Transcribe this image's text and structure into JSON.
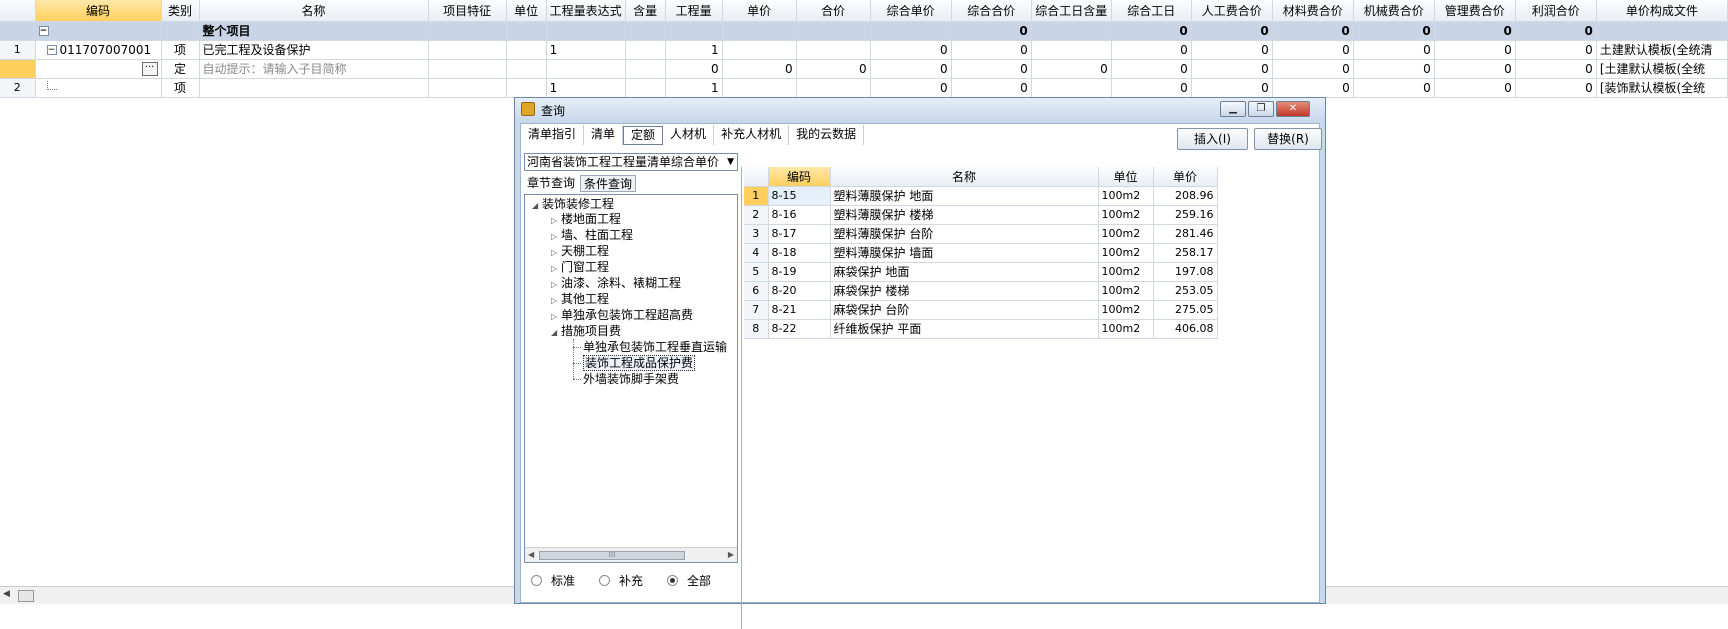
{
  "grid": {
    "headers": [
      "编码",
      "类别",
      "名称",
      "项目特征",
      "单位",
      "工程量表达式",
      "含量",
      "工程量",
      "单价",
      "合价",
      "综合单价",
      "综合合价",
      "综合工日含量",
      "综合工日",
      "人工费合价",
      "材料费合价",
      "机械费合价",
      "管理费合价",
      "利润合价",
      "单价构成文件"
    ],
    "summary": {
      "toggle": "−",
      "name": "整个项目",
      "zhhj": "0",
      "zhgr": "0",
      "rgf": "0",
      "clf": "0",
      "jxf": "0",
      "glf": "0",
      "lr": "0"
    },
    "row1": {
      "num": "1",
      "toggle": "−",
      "code": "011707007001",
      "type": "项",
      "name": "已完工程及设备保护",
      "expr": "1",
      "qty": "1",
      "zhdj": "0",
      "zhhj": "0",
      "zhgr": "0",
      "rgf": "0",
      "clf": "0",
      "jxf": "0",
      "glf": "0",
      "lr": "0",
      "file": "土建默认模板(全统清"
    },
    "row_sub": {
      "btn": "···",
      "type": "定",
      "hint": "自动提示：请输入子目简称",
      "qty": "0",
      "dj": "0",
      "hj": "0",
      "zhdj": "0",
      "zhhj": "0",
      "grhl": "0",
      "zhgr": "0",
      "rgf": "0",
      "clf": "0",
      "jxf": "0",
      "glf": "0",
      "lr": "0",
      "file": "[土建默认模板(全统"
    },
    "row2": {
      "num": "2",
      "type": "项",
      "expr": "1",
      "qty": "1",
      "zhdj": "0",
      "zhhj": "0",
      "zhgr": "0",
      "rgf": "0",
      "clf": "0",
      "jxf": "0",
      "glf": "0",
      "lr": "0",
      "file": "[装饰默认模板(全统"
    }
  },
  "dialog": {
    "title": "查询",
    "tabs": [
      "清单指引",
      "清单",
      "定额",
      "人材机",
      "补充人材机",
      "我的云数据"
    ],
    "insert_label": "插入(I)",
    "replace_label": "替换(R)",
    "combo_value": "河南省装饰工程工程量清单综合单价",
    "subtabs": [
      "章节查询",
      "条件查询"
    ],
    "tree": {
      "root": "装饰装修工程",
      "children": [
        "楼地面工程",
        "墙、柱面工程",
        "天棚工程",
        "门窗工程",
        "油漆、涂料、裱糊工程",
        "其他工程",
        "单独承包装饰工程超高费"
      ],
      "open": "措施项目费",
      "leaves": [
        "单独承包装饰工程垂直运输",
        "装饰工程成品保护费",
        "外墙装饰脚手架费"
      ]
    },
    "radios": [
      "标准",
      "补充",
      "全部"
    ],
    "table": {
      "headers": [
        "编码",
        "名称",
        "单位",
        "单价"
      ],
      "rows": [
        {
          "n": "1",
          "code": "8-15",
          "name": "塑料薄膜保护 地面",
          "unit": "100m2",
          "price": "208.96"
        },
        {
          "n": "2",
          "code": "8-16",
          "name": "塑料薄膜保护 楼梯",
          "unit": "100m2",
          "price": "259.16"
        },
        {
          "n": "3",
          "code": "8-17",
          "name": "塑料薄膜保护 台阶",
          "unit": "100m2",
          "price": "281.46"
        },
        {
          "n": "4",
          "code": "8-18",
          "name": "塑料薄膜保护 墙面",
          "unit": "100m2",
          "price": "258.17"
        },
        {
          "n": "5",
          "code": "8-19",
          "name": "麻袋保护 地面",
          "unit": "100m2",
          "price": "197.08"
        },
        {
          "n": "6",
          "code": "8-20",
          "name": "麻袋保护 楼梯",
          "unit": "100m2",
          "price": "253.05"
        },
        {
          "n": "7",
          "code": "8-21",
          "name": "麻袋保护 台阶",
          "unit": "100m2",
          "price": "275.05"
        },
        {
          "n": "8",
          "code": "8-22",
          "name": "纤维板保护 平面",
          "unit": "100m2",
          "price": "406.08"
        }
      ]
    }
  }
}
